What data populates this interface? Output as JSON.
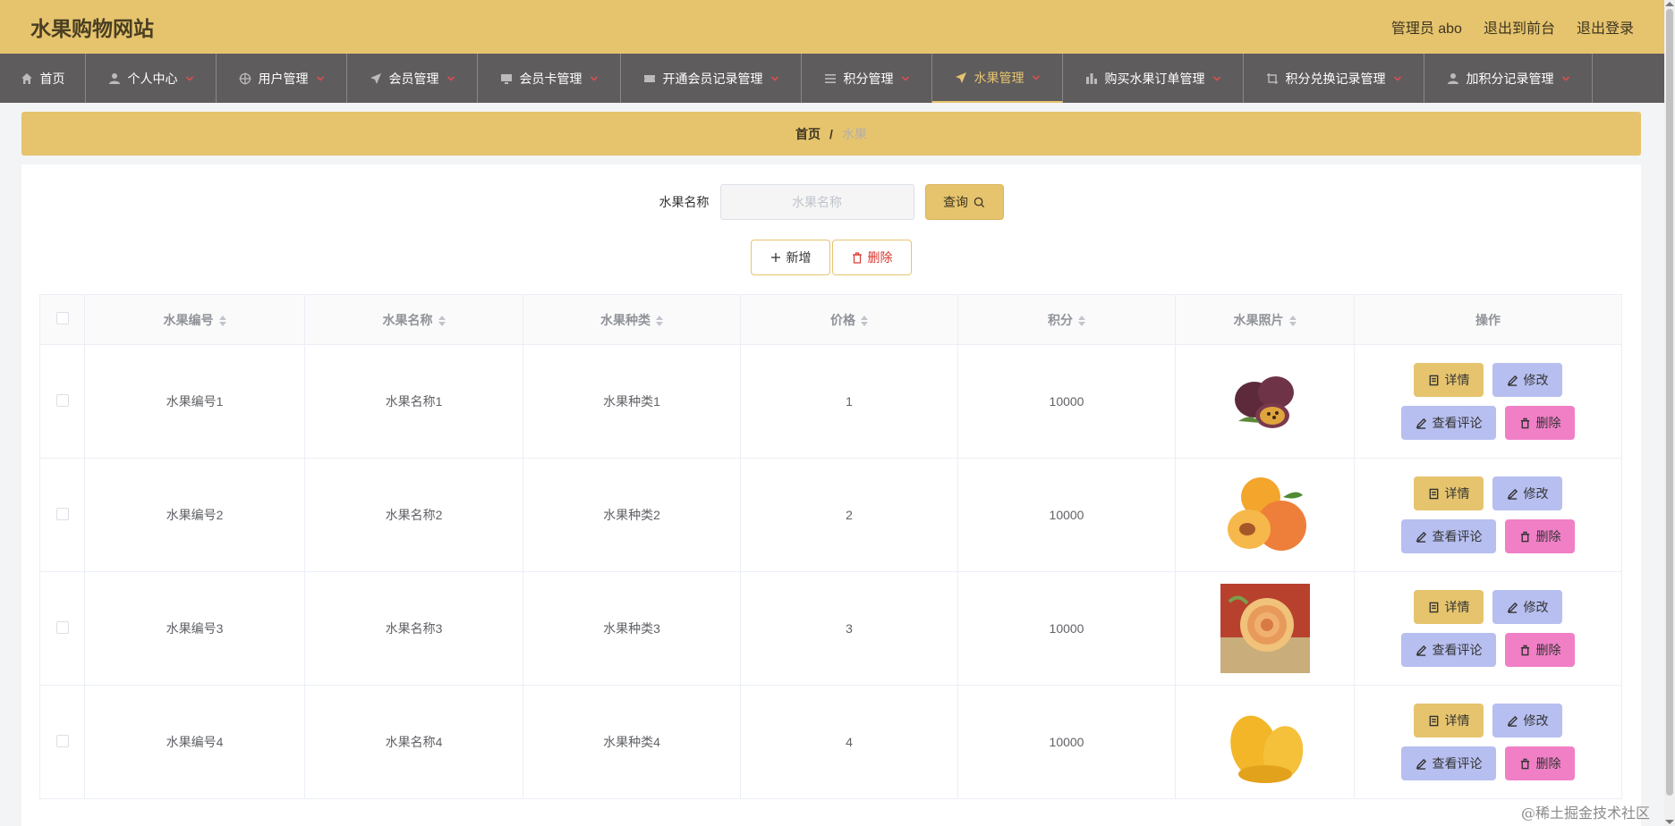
{
  "header": {
    "site_title": "水果购物网站",
    "admin": "管理员 abo",
    "back_to_front": "退出到前台",
    "logout": "退出登录"
  },
  "nav": [
    {
      "label": "首页",
      "icon": "home-icon",
      "has_caret": false,
      "active": false
    },
    {
      "label": "个人中心",
      "icon": "user-icon",
      "has_caret": true,
      "active": false
    },
    {
      "label": "用户管理",
      "icon": "target-icon",
      "has_caret": true,
      "active": false
    },
    {
      "label": "会员管理",
      "icon": "send-icon",
      "has_caret": true,
      "active": false
    },
    {
      "label": "会员卡管理",
      "icon": "monitor-icon",
      "has_caret": true,
      "active": false
    },
    {
      "label": "开通会员记录管理",
      "icon": "ticket-icon",
      "has_caret": true,
      "active": false
    },
    {
      "label": "积分管理",
      "icon": "list-icon",
      "has_caret": true,
      "active": false
    },
    {
      "label": "水果管理",
      "icon": "send-icon",
      "has_caret": true,
      "active": true
    },
    {
      "label": "购买水果订单管理",
      "icon": "chart-icon",
      "has_caret": true,
      "active": false
    },
    {
      "label": "积分兑换记录管理",
      "icon": "crop-icon",
      "has_caret": true,
      "active": false
    },
    {
      "label": "加积分记录管理",
      "icon": "user-icon",
      "has_caret": true,
      "active": false
    }
  ],
  "breadcrumb": {
    "home": "首页",
    "separator": "/",
    "current": "水果"
  },
  "search": {
    "label": "水果名称",
    "placeholder": "水果名称",
    "value": "",
    "button": "查询"
  },
  "actions": {
    "add": "新增",
    "delete": "删除"
  },
  "table": {
    "columns": [
      "水果编号",
      "水果名称",
      "水果种类",
      "价格",
      "积分",
      "水果照片",
      "操作"
    ],
    "rows": [
      {
        "code": "水果编号1",
        "name": "水果名称1",
        "type": "水果种类1",
        "price": "1",
        "points": "10000",
        "photo": "passion-fruit"
      },
      {
        "code": "水果编号2",
        "name": "水果名称2",
        "type": "水果种类2",
        "price": "2",
        "points": "10000",
        "photo": "apricot"
      },
      {
        "code": "水果编号3",
        "name": "水果名称3",
        "type": "水果种类3",
        "price": "3",
        "points": "10000",
        "photo": "carved-melon"
      },
      {
        "code": "水果编号4",
        "name": "水果名称4",
        "type": "水果种类4",
        "price": "4",
        "points": "10000",
        "photo": "mango"
      }
    ],
    "row_actions": {
      "detail": "详情",
      "edit": "修改",
      "review": "查看评论",
      "delete": "删除"
    }
  },
  "watermark": "@稀土掘金技术社区",
  "colors": {
    "accent": "#e6c46e",
    "nav_bg": "#5f5c5e",
    "edit_btn": "#b7bff0",
    "delete_btn": "#f07fc6"
  }
}
